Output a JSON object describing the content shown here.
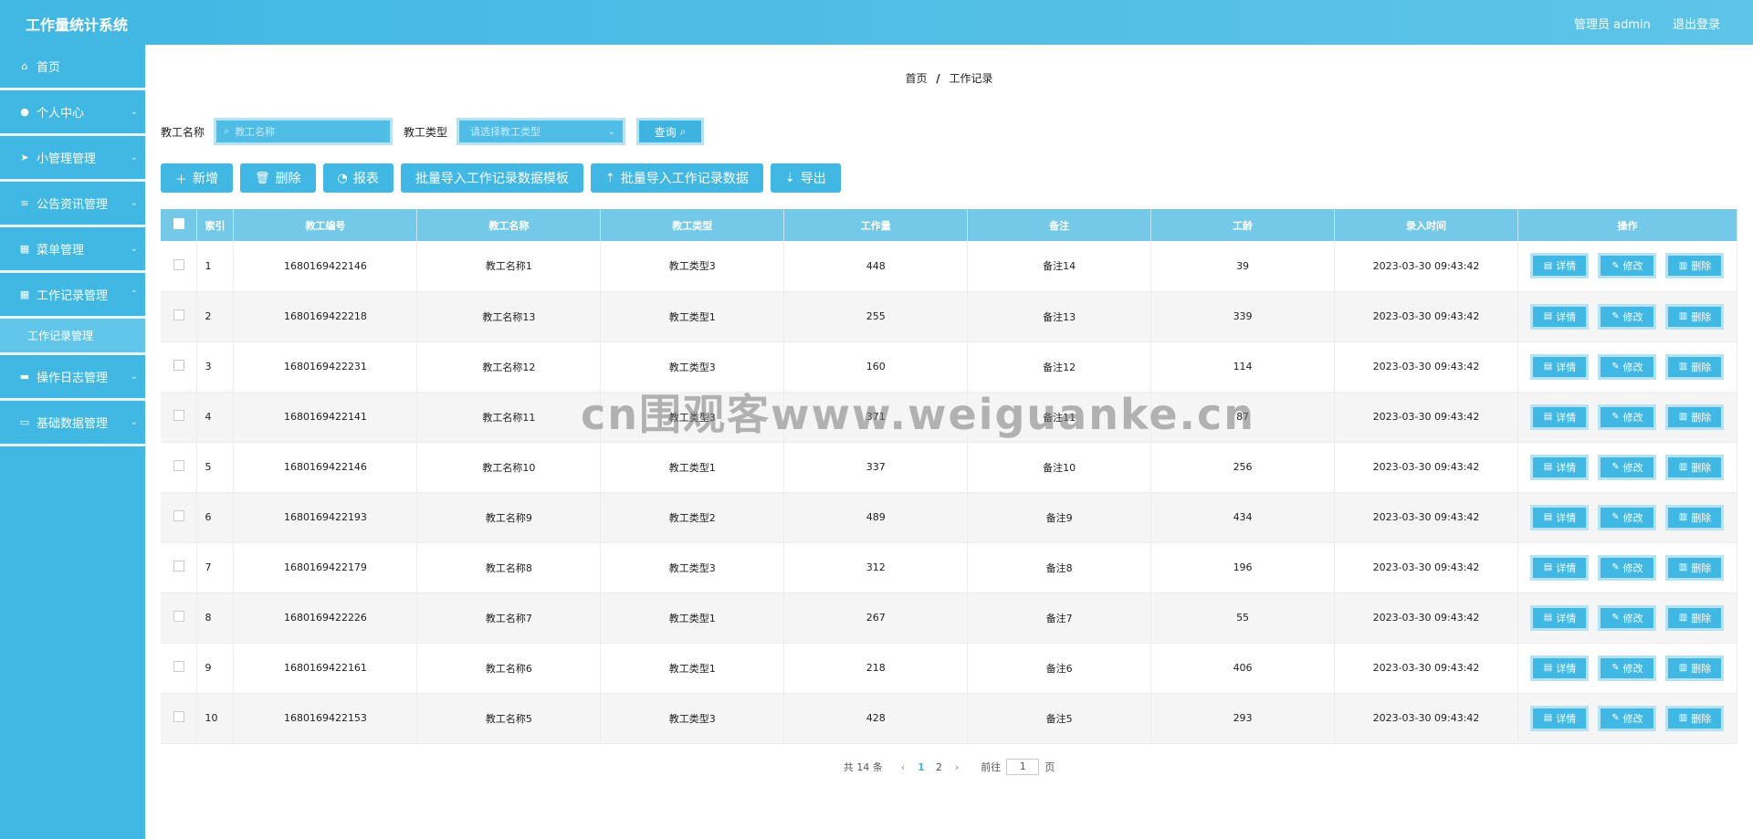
{
  "header": {
    "app_title": "工作量统计系统",
    "user_label": "管理员 admin",
    "logout_label": "退出登录"
  },
  "sidebar": {
    "items": [
      {
        "label": "首页",
        "icon": "home-icon"
      },
      {
        "label": "个人中心",
        "icon": "user-icon"
      },
      {
        "label": "小管理管理",
        "icon": "send-icon"
      },
      {
        "label": "公告资讯管理",
        "icon": "list-icon"
      },
      {
        "label": "菜单管理",
        "icon": "grid-icon"
      },
      {
        "label": "工作记录管理",
        "icon": "grid-icon"
      },
      {
        "label": "操作日志管理",
        "icon": "log-icon"
      },
      {
        "label": "基础数据管理",
        "icon": "monitor-icon"
      }
    ],
    "submenu": {
      "label": "工作记录管理"
    }
  },
  "breadcrumb": {
    "home": "首页",
    "sep": "/",
    "current": "工作记录"
  },
  "filters": {
    "name_label": "教工名称",
    "name_placeholder": "教工名称",
    "type_label": "教工类型",
    "type_placeholder": "请选择教工类型",
    "query_label": "查询"
  },
  "toolbar": {
    "add": "新增",
    "delete": "删除",
    "report": "报表",
    "import_template": "批量导入工作记录数据模板",
    "import_data": "批量导入工作记录数据",
    "export": "导出"
  },
  "table": {
    "columns": [
      "索引",
      "教工编号",
      "教工名称",
      "教工类型",
      "工作量",
      "备注",
      "工龄",
      "录入时间",
      "操作"
    ],
    "rows": [
      [
        "1",
        "1680169422146",
        "教工名称1",
        "教工类型3",
        "448",
        "备注14",
        "39",
        "2023-03-30 09:43:42"
      ],
      [
        "2",
        "1680169422218",
        "教工名称13",
        "教工类型1",
        "255",
        "备注13",
        "339",
        "2023-03-30 09:43:42"
      ],
      [
        "3",
        "1680169422231",
        "教工名称12",
        "教工类型3",
        "160",
        "备注12",
        "114",
        "2023-03-30 09:43:42"
      ],
      [
        "4",
        "1680169422141",
        "教工名称11",
        "教工类型3",
        "371",
        "备注11",
        "87",
        "2023-03-30 09:43:42"
      ],
      [
        "5",
        "1680169422146",
        "教工名称10",
        "教工类型1",
        "337",
        "备注10",
        "256",
        "2023-03-30 09:43:42"
      ],
      [
        "6",
        "1680169422193",
        "教工名称9",
        "教工类型2",
        "489",
        "备注9",
        "434",
        "2023-03-30 09:43:42"
      ],
      [
        "7",
        "1680169422179",
        "教工名称8",
        "教工类型3",
        "312",
        "备注8",
        "196",
        "2023-03-30 09:43:42"
      ],
      [
        "8",
        "1680169422226",
        "教工名称7",
        "教工类型1",
        "267",
        "备注7",
        "55",
        "2023-03-30 09:43:42"
      ],
      [
        "9",
        "1680169422161",
        "教工名称6",
        "教工类型1",
        "218",
        "备注6",
        "406",
        "2023-03-30 09:43:42"
      ],
      [
        "10",
        "1680169422153",
        "教工名称5",
        "教工类型3",
        "428",
        "备注5",
        "293",
        "2023-03-30 09:43:42"
      ]
    ],
    "ops": {
      "detail": "详情",
      "edit": "修改",
      "delete": "删除"
    }
  },
  "pager": {
    "total_text": "共 14 条",
    "pages": [
      "1",
      "2"
    ],
    "active_page": "1",
    "goto_label": "前往",
    "goto_value": "1",
    "page_suffix": "页"
  },
  "watermark": "cn围观客www.weiguanke.cn",
  "colors": {
    "primary": "#41b7e3",
    "header_bg": "#74c9e8"
  }
}
